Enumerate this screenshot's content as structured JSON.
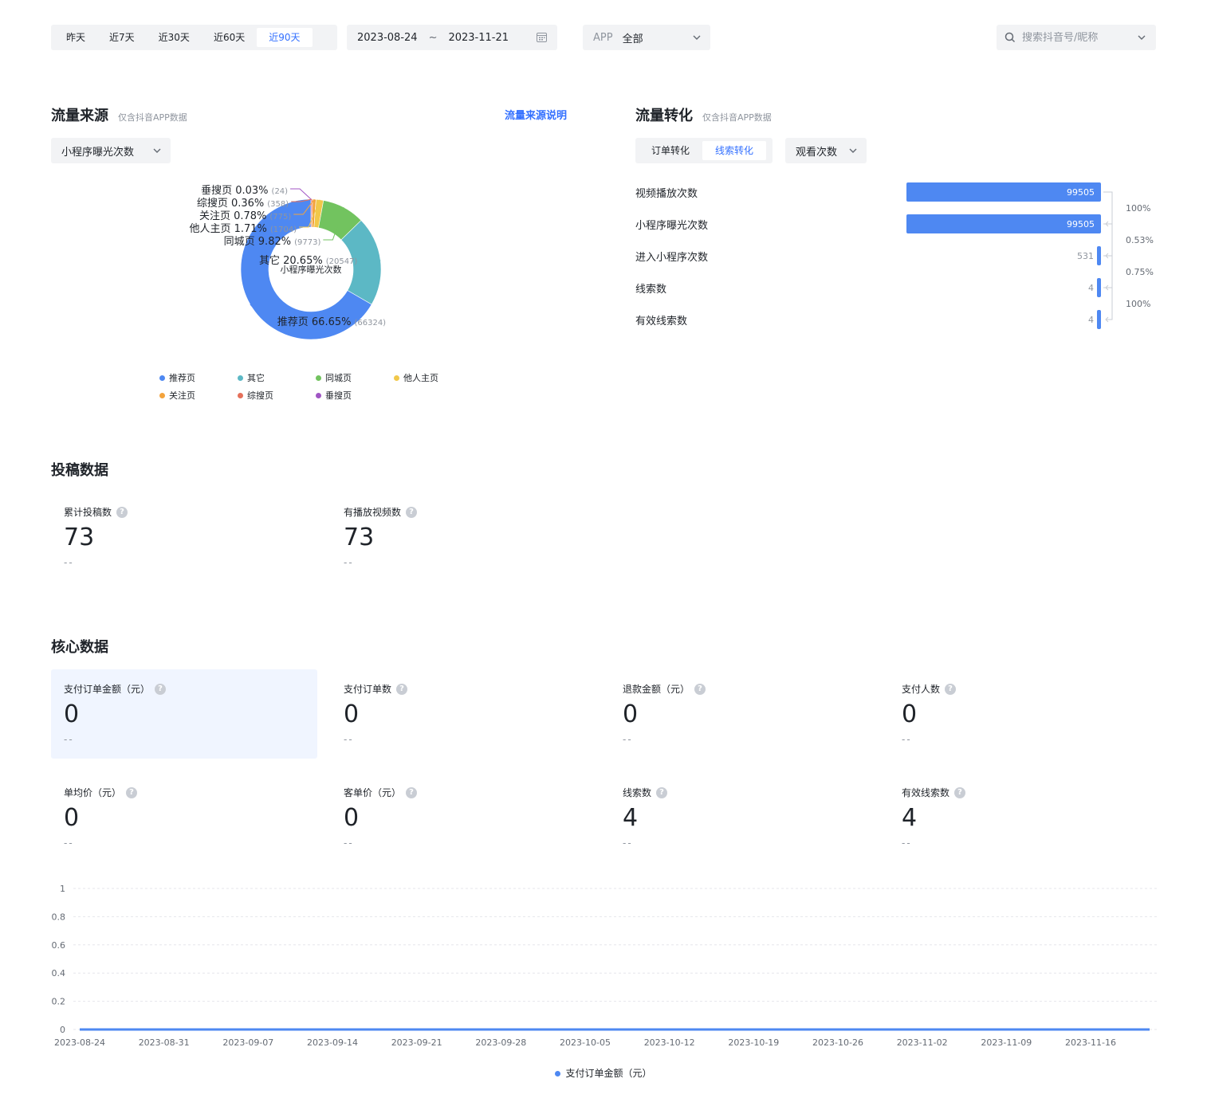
{
  "filters": {
    "range_tabs": [
      "昨天",
      "近7天",
      "近30天",
      "近60天",
      "近90天"
    ],
    "active_range": 4,
    "date_start": "2023-08-24",
    "date_sep": "~",
    "date_end": "2023-11-21",
    "app_label": "APP",
    "app_value": "全部",
    "search_placeholder": "搜索抖音号/昵称"
  },
  "traffic_source": {
    "title": "流量来源",
    "subtitle": "仅含抖音APP数据",
    "help_link": "流量来源说明",
    "metric_select": "小程序曝光次数",
    "center_label": "小程序曝光次数"
  },
  "traffic_conversion": {
    "title": "流量转化",
    "subtitle": "仅含抖音APP数据",
    "tabs": [
      "订单转化",
      "线索转化"
    ],
    "active_tab": 1,
    "metric_select": "观看次数"
  },
  "submission": {
    "title": "投稿数据",
    "metrics": [
      {
        "label": "累计投稿数",
        "value": "73",
        "delta": "--"
      },
      {
        "label": "有播放视频数",
        "value": "73",
        "delta": "--"
      }
    ]
  },
  "core": {
    "title": "核心数据",
    "metrics": [
      {
        "label": "支付订单金额（元）",
        "value": "0",
        "delta": "--"
      },
      {
        "label": "支付订单数",
        "value": "0",
        "delta": "--"
      },
      {
        "label": "退款金额（元）",
        "value": "0",
        "delta": "--"
      },
      {
        "label": "支付人数",
        "value": "0",
        "delta": "--"
      },
      {
        "label": "单均价（元）",
        "value": "0",
        "delta": "--"
      },
      {
        "label": "客单价（元）",
        "value": "0",
        "delta": "--"
      },
      {
        "label": "线索数",
        "value": "4",
        "delta": "--"
      },
      {
        "label": "有效线索数",
        "value": "4",
        "delta": "--"
      }
    ],
    "active_metric": 0
  },
  "colors": {
    "accent": "#3370ff",
    "blue": "#4e88f2",
    "teal": "#5cb8c5",
    "green": "#72c35f",
    "yellow": "#f1c84a",
    "orange": "#f3a33c",
    "red": "#e5705a",
    "purple": "#a056c4"
  },
  "chart_data": [
    {
      "type": "pie",
      "title": "流量来源",
      "center_label": "小程序曝光次数",
      "slices": [
        {
          "name": "推荐页",
          "percent": "66.65%",
          "count": 66324,
          "color": "#4e88f2"
        },
        {
          "name": "其它",
          "percent": "20.65%",
          "count": 20547,
          "color": "#5cb8c5"
        },
        {
          "name": "同城页",
          "percent": "9.82%",
          "count": 9773,
          "color": "#72c35f"
        },
        {
          "name": "他人主页",
          "percent": "1.71%",
          "count": 1704,
          "color": "#f1c84a"
        },
        {
          "name": "关注页",
          "percent": "0.78%",
          "count": 775,
          "color": "#f3a33c"
        },
        {
          "name": "综搜页",
          "percent": "0.36%",
          "count": 358,
          "color": "#e5705a"
        },
        {
          "name": "垂搜页",
          "percent": "0.03%",
          "count": 24,
          "color": "#a056c4"
        }
      ],
      "legend": [
        "推荐页",
        "其它",
        "同城页",
        "他人主页",
        "关注页",
        "综搜页",
        "垂搜页"
      ]
    },
    {
      "type": "bar",
      "title": "流量转化",
      "categories": [
        "视频播放次数",
        "小程序曝光次数",
        "进入小程序次数",
        "线索数",
        "有效线索数"
      ],
      "values": [
        99505,
        99505,
        531,
        4,
        4
      ],
      "rates": [
        "100%",
        "0.53%",
        "0.75%",
        "100%"
      ]
    },
    {
      "type": "line",
      "x": [
        "2023-08-24",
        "2023-08-31",
        "2023-09-07",
        "2023-09-14",
        "2023-09-21",
        "2023-09-28",
        "2023-10-05",
        "2023-10-12",
        "2023-10-19",
        "2023-10-26",
        "2023-11-02",
        "2023-11-09",
        "2023-11-16"
      ],
      "series": [
        {
          "name": "支付订单金额（元）",
          "values": [
            0,
            0,
            0,
            0,
            0,
            0,
            0,
            0,
            0,
            0,
            0,
            0,
            0
          ]
        }
      ],
      "y_ticks": [
        "1",
        "0.8",
        "0.6",
        "0.4",
        "0.2",
        "0"
      ],
      "ylim": [
        0,
        1
      ],
      "grid": true
    }
  ]
}
